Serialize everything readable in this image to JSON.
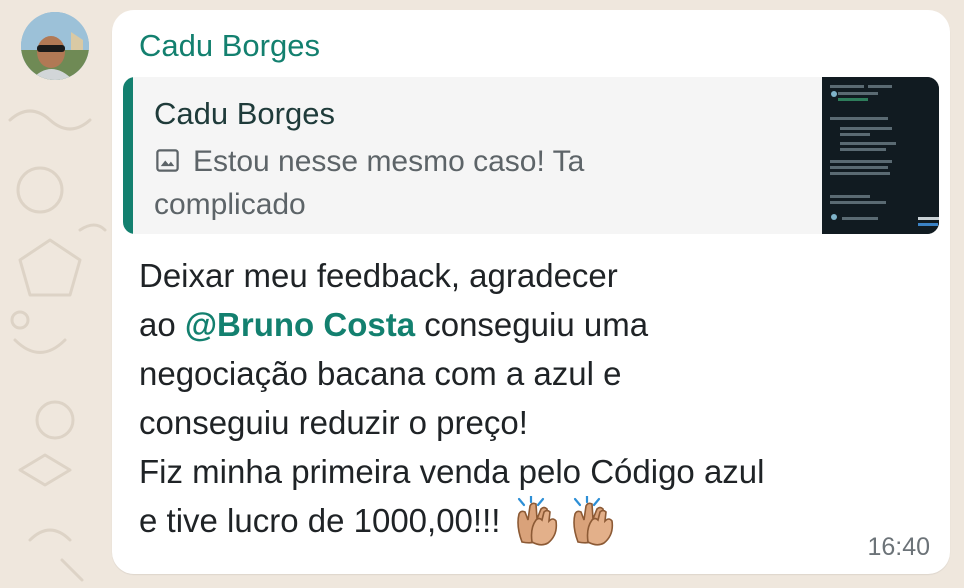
{
  "message": {
    "sender": "Cadu Borges",
    "quote": {
      "author": "Cadu Borges",
      "text": "Estou nesse mesmo caso! Ta complicado",
      "media_icon": "photo-icon"
    },
    "lines": [
      {
        "text": "Deixar meu feedback,  agradecer"
      },
      {
        "before": "ao ",
        "mention": "@Bruno Costa",
        "after": " conseguiu uma"
      },
      {
        "text": "negociação bacana com a azul e"
      },
      {
        "text": "conseguiu reduzir o preço!"
      },
      {
        "text": "Fiz minha primeira venda pelo Código azul"
      },
      {
        "text": "e tive lucro de 1000,00!!! "
      }
    ],
    "emoji": [
      "clapping-hands",
      "clapping-hands"
    ],
    "time": "16:40"
  },
  "colors": {
    "background": "#efe7dd",
    "bubble": "#ffffff",
    "accent": "#13806f",
    "quote_background": "#f5f5f5",
    "text": "#1f2326",
    "meta_text": "#6c7378"
  }
}
